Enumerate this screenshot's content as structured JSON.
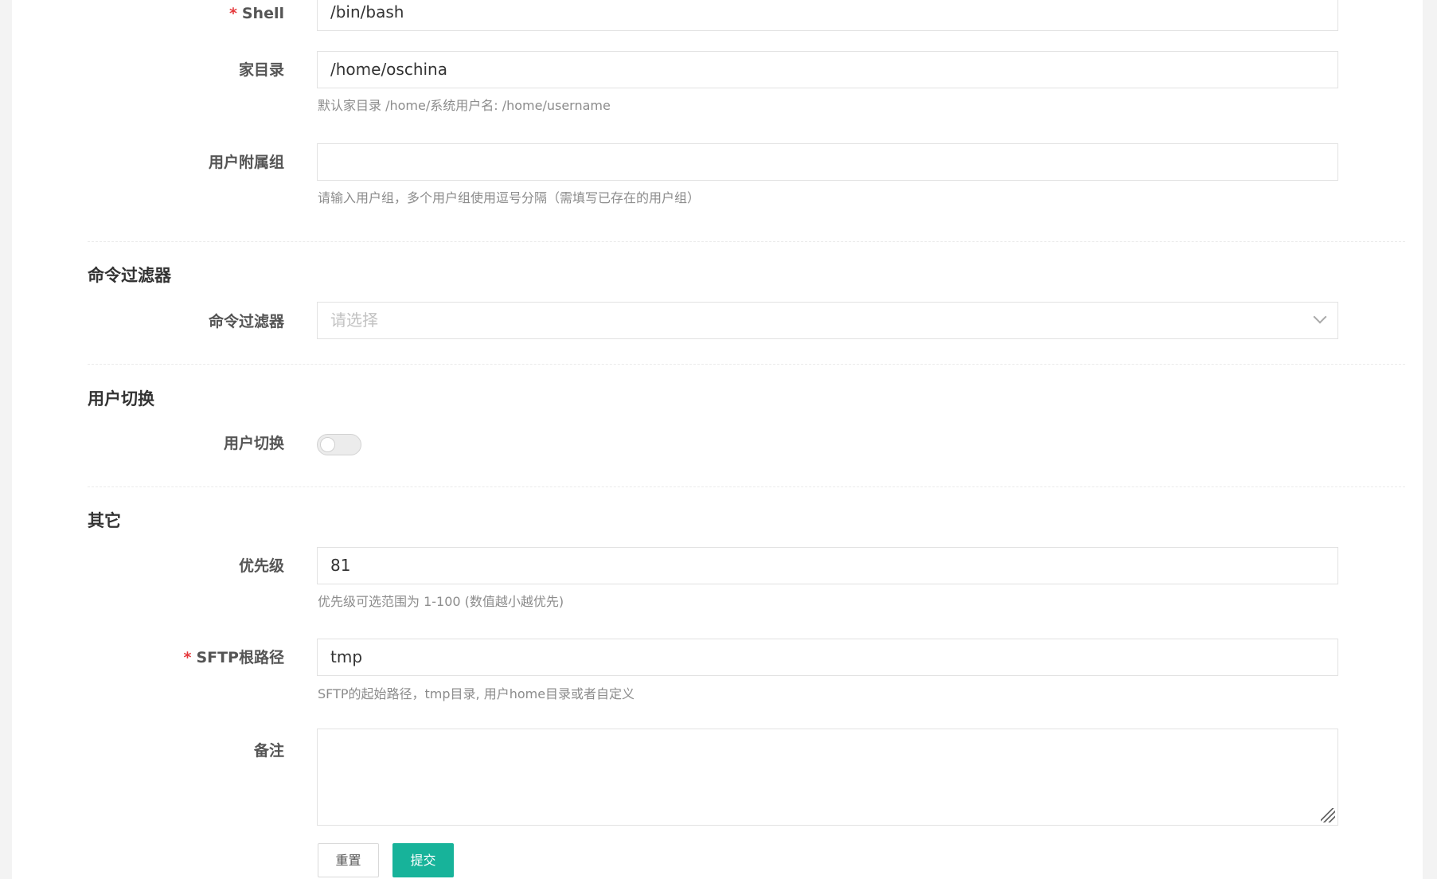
{
  "form": {
    "shell": {
      "label": "Shell",
      "required": "*",
      "value": "/bin/bash"
    },
    "home": {
      "label": "家目录",
      "value": "/home/oschina",
      "help": "默认家目录 /home/系统用户名: /home/username"
    },
    "groups": {
      "label": "用户附属组",
      "value": "",
      "help": "请输入用户组，多个用户组使用逗号分隔（需填写已存在的用户组）"
    }
  },
  "sections": {
    "filter": {
      "title": "命令过滤器",
      "label": "命令过滤器",
      "placeholder": "请选择",
      "icon": "chevron-down-icon"
    },
    "switch": {
      "title": "用户切换",
      "label": "用户切换",
      "enabled": false
    },
    "other": {
      "title": "其它",
      "priority": {
        "label": "优先级",
        "value": "81",
        "help": "优先级可选范围为 1-100 (数值越小越优先)"
      },
      "sftp": {
        "label": "SFTP根路径",
        "required": "*",
        "value": "tmp",
        "help": "SFTP的起始路径，tmp目录, 用户home目录或者自定义"
      },
      "note": {
        "label": "备注",
        "value": ""
      }
    }
  },
  "actions": {
    "reset": "重置",
    "submit": "提交"
  },
  "colors": {
    "accent": "#17b39a",
    "required": "#e5393c"
  }
}
